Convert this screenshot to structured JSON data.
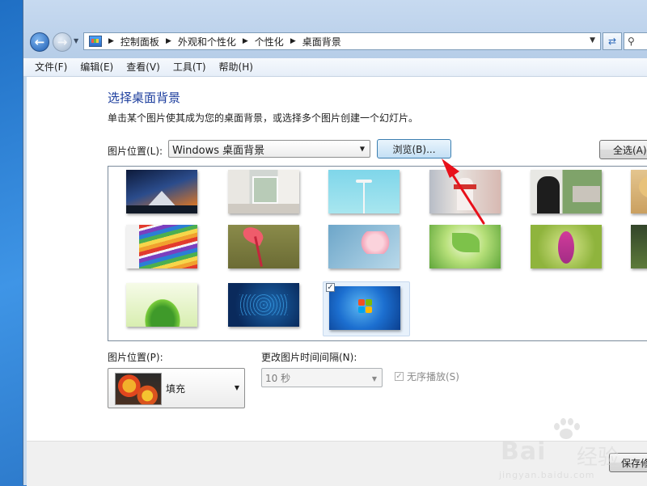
{
  "address": {
    "crumbs": [
      "控制面板",
      "外观和个性化",
      "个性化",
      "桌面背景"
    ]
  },
  "menu": [
    "文件(F)",
    "编辑(E)",
    "查看(V)",
    "工具(T)",
    "帮助(H)"
  ],
  "page": {
    "heading": "选择桌面背景",
    "description": "单击某个图片使其成为您的桌面背景，或选择多个图片创建一个幻灯片。",
    "location_label": "图片位置(L):",
    "location_value": "Windows 桌面背景",
    "browse_label": "浏览(B)...",
    "select_all_label": "全选(A)"
  },
  "gallery": {
    "thumbnails": [
      {
        "icon": "mountain-night-image"
      },
      {
        "icon": "white-room-image"
      },
      {
        "icon": "streetlight-sky-image"
      },
      {
        "icon": "girl-with-scarf-image"
      },
      {
        "icon": "graduation-photo-image"
      },
      {
        "icon": "hat-photo-image"
      },
      {
        "icon": "colored-pencils-image"
      },
      {
        "icon": "red-flower-image"
      },
      {
        "icon": "pink-blossom-image"
      },
      {
        "icon": "green-leaves-image"
      },
      {
        "icon": "purple-flower-image"
      },
      {
        "icon": "dark-leaf-image"
      },
      {
        "icon": "green-plant-image"
      },
      {
        "icon": "world-map-image"
      },
      {
        "icon": "windows7-logo-image",
        "selected": true
      }
    ]
  },
  "bottom": {
    "position_label": "图片位置(P):",
    "position_value": "填充",
    "interval_label": "更改图片时间间隔(N):",
    "interval_value": "10 秒",
    "shuffle_label": "无序播放(S)",
    "save_label": "保存修"
  },
  "watermark": {
    "brand": "Bai",
    "brand2": "经验",
    "url": "jingyan.baidu.com"
  }
}
